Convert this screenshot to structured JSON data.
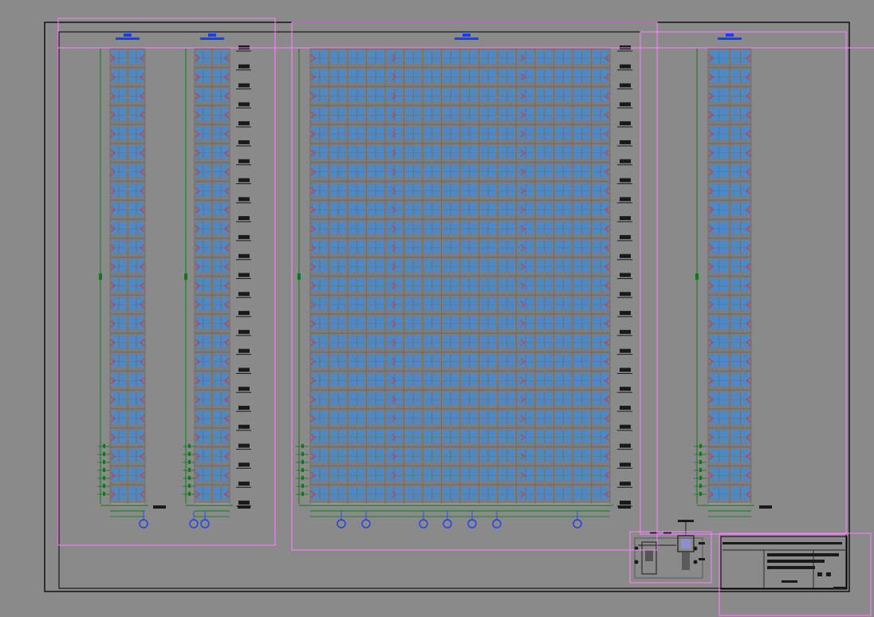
{
  "app": {
    "type": "CAD drawing sheet",
    "background_color": "#8a8a8a"
  },
  "colors": {
    "frame": "#000000",
    "viewport": "#ff80ff",
    "window_glass": "#3f8ee0",
    "mullion": "#6e6e6e",
    "outline": "#b0b0b0",
    "door_marker": "#d33a3a",
    "dimension": "#0b7a18",
    "level_mark": "#1a1a1a",
    "title_mark": "#1e3cff",
    "axis_bubble": "#1e3cff"
  },
  "elevations": [
    {
      "id": "elevation-1",
      "floors": 24,
      "bays": 2,
      "axis_bubbles": 1
    },
    {
      "id": "elevation-2",
      "floors": 24,
      "bays": 2,
      "axis_bubbles": 2
    },
    {
      "id": "elevation-3",
      "floors": 24,
      "bays": 16,
      "axis_bubbles": 7
    },
    {
      "id": "elevation-4",
      "floors": 24,
      "bays": 2,
      "axis_bubbles": 0
    }
  ],
  "title_block": {
    "rows": 8,
    "text_visible": false
  }
}
